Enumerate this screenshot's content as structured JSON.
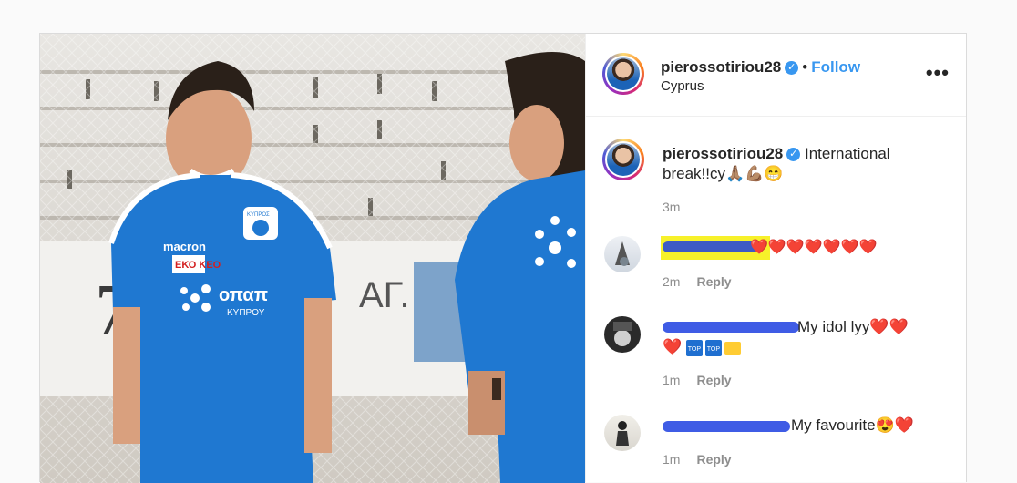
{
  "post": {
    "username": "pierossotiriou28",
    "verified_icon": "verified-badge-icon",
    "follow_label": "Follow",
    "separator": "•",
    "location": "Cyprus",
    "more_label": "•••"
  },
  "caption": {
    "username": "pierossotiriou28",
    "text": "International break!!cy🙏🏽💪🏽😁",
    "time": "3m"
  },
  "comments": [
    {
      "text": "❤️❤️❤️❤️❤️❤️❤️",
      "time": "2m",
      "reply_label": "Reply",
      "redacted": true
    },
    {
      "text": "My idol lyy❤️❤️",
      "text2": "❤️",
      "time": "1m",
      "reply_label": "Reply",
      "redacted": true
    },
    {
      "text": "My favourite😍❤️",
      "time": "1m",
      "reply_label": "Reply",
      "redacted": true
    }
  ],
  "photo": {
    "jersey_brand": "macron",
    "sponsor": "ΕΚΟ",
    "sponsor2": "KEO",
    "jersey_text": "οπαπ",
    "jersey_sub": "ΚΥΠΡΟΥ",
    "crest": "ΚΥΠΡΟΣ"
  },
  "colors": {
    "link": "#3897f0",
    "jersey": "#1f78d1",
    "highlight": "#f7f12a",
    "scribble": "#1d3fe0"
  }
}
